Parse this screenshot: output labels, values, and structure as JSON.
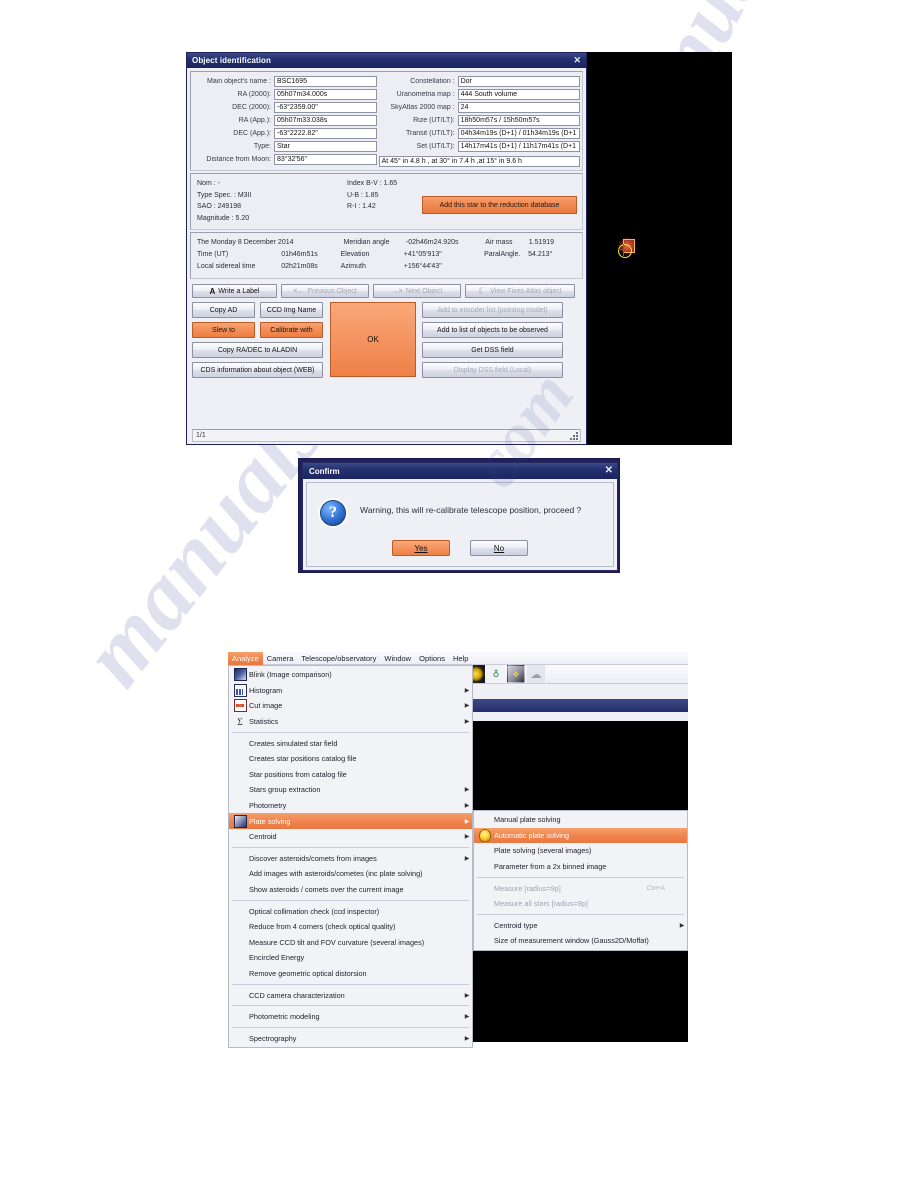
{
  "watermark": {
    "line1": "manualshive.com",
    "line2": "manualshive",
    "line3": "com"
  },
  "object_dialog": {
    "title": "Object identification",
    "close_label": "✕",
    "left_fields": [
      {
        "label": "Main object's name :",
        "value": "BSC1695"
      },
      {
        "label": "RA (2000):",
        "value": "05h07m34.000s"
      },
      {
        "label": "DEC (2000):",
        "value": "-63°2359.00\""
      },
      {
        "label": "RA (App.):",
        "value": "05h07m33.038s"
      },
      {
        "label": "DEC (App.):",
        "value": "-63°2222.82\""
      },
      {
        "label": "Type:",
        "value": "Star"
      },
      {
        "label": "Distance from Moon:",
        "value": "83°32'56\""
      }
    ],
    "right_fields": [
      {
        "label": "Constellation :",
        "value": "Dor"
      },
      {
        "label": "Uranometria map :",
        "value": "444  South volume"
      },
      {
        "label": "SkyAtlas 2000 map :",
        "value": "24"
      },
      {
        "label": "Rize    (UT/LT):",
        "value": "18h50m57s / 15h50m57s"
      },
      {
        "label": "Transit (UT/LT):",
        "value": "04h34m19s (D+1)  / 01h34m19s (D+1"
      },
      {
        "label": "Set     (UT/LT):",
        "value": "14h17m41s (D+1) / 11h17m41s (D+1"
      }
    ],
    "altitude_note": "At 45° in 4.8 h , at 30° in 7.4 h ,at 15° in 9.6 h",
    "catalog": {
      "col1": [
        "Nom : -",
        "Type Spec. : M3II",
        "SAO : 249198",
        "Magnitude : 5.20"
      ],
      "col2": [
        "Index B-V : 1.65",
        "U-B : 1.85",
        "R-I : 1.42"
      ],
      "add_button": "Add this star to the reduction database"
    },
    "ephemeris": {
      "row1": {
        "c1": "The Monday 8 December 2014",
        "c2": "",
        "c3": "Meridian angle",
        "c4": "-02h46m24.920s",
        "c5": "Air mass",
        "c6": "1.51919"
      },
      "row2": {
        "c1": "Time (UT)",
        "c2": "01h46m51s",
        "c3": "Elevation",
        "c4": "+41°05'913\"",
        "c5": "ParalAngle.",
        "c6": "54.213°"
      },
      "row3": {
        "c1": "Local sidereal time",
        "c2": "02h21m08s",
        "c3": "Azimuth",
        "c4": "+156°44'43\"",
        "c5": "",
        "c6": ""
      }
    },
    "buttons": {
      "write_label": "Write a Label",
      "write_label_glyph": "A",
      "previous_object": "Previous Object",
      "previous_glyph": "<←",
      "next_object": "Next Object",
      "next_glyph": "→>",
      "fixed_atlas": "View Fixes Atlas object",
      "moon_glyph": "☾",
      "copy_ad": "Copy AD",
      "ccd_img_name": "CCD Img Name",
      "slew_to": "Slew to",
      "calibrate_with": "Calibrate with",
      "copy_aladin": "Copy RA/DEC to ALADIN",
      "cds_info": "CDS information about object (WEB)",
      "ok": "OK",
      "add_encoder": "Add to encoder list (pointing model)",
      "add_to_list": "Add to list of objects to be observed",
      "get_dss": "Get DSS field",
      "display_dss": "Display DSS field (Local)"
    },
    "status": "1/1"
  },
  "confirm_dialog": {
    "title": "Confirm",
    "close_label": "✕",
    "icon": "?",
    "message": "Warning, this will re-calibrate telescope position, proceed ?",
    "yes": "Yes",
    "no": "No"
  },
  "menu_window": {
    "menubar": [
      {
        "label": "Analyze",
        "active": true
      },
      {
        "label": "Camera",
        "active": false
      },
      {
        "label": "Telescope/observatory",
        "active": false
      },
      {
        "label": "Window",
        "active": false
      },
      {
        "label": "Options",
        "active": false
      },
      {
        "label": "Help",
        "active": false
      }
    ],
    "toolbar": [
      {
        "name": "star-tool",
        "glyph": ""
      },
      {
        "name": "green-tool",
        "glyph": "♁"
      },
      {
        "name": "camera-tool",
        "glyph": "❖"
      },
      {
        "name": "cloud-tool",
        "glyph": "☁"
      }
    ],
    "analyze_menu": [
      {
        "label": "Blink (Image comparison)",
        "icon": "blink-icon",
        "arrow": false,
        "sep_after": false,
        "selected": false,
        "disabled": false
      },
      {
        "label": "Histogram",
        "icon": "histogram-icon",
        "arrow": true,
        "sep_after": false,
        "selected": false,
        "disabled": false
      },
      {
        "label": "Cut image",
        "icon": "cut-image-icon",
        "arrow": true,
        "sep_after": false,
        "selected": false,
        "disabled": false
      },
      {
        "label": "Statistics",
        "icon": "sigma-icon",
        "arrow": true,
        "sep_after": true,
        "selected": false,
        "disabled": false
      },
      {
        "label": "Creates simulated star field",
        "icon": "",
        "arrow": false,
        "sep_after": false,
        "selected": false,
        "disabled": false
      },
      {
        "label": "Creates star positions catalog file",
        "icon": "",
        "arrow": false,
        "sep_after": false,
        "selected": false,
        "disabled": false
      },
      {
        "label": "Star positions from catalog file",
        "icon": "",
        "arrow": false,
        "sep_after": false,
        "selected": false,
        "disabled": false
      },
      {
        "label": "Stars group extraction",
        "icon": "",
        "arrow": true,
        "sep_after": false,
        "selected": false,
        "disabled": false
      },
      {
        "label": "Photometry",
        "icon": "",
        "arrow": true,
        "sep_after": false,
        "selected": false,
        "disabled": false
      },
      {
        "label": "Plate solving",
        "icon": "plate-solving-icon",
        "arrow": true,
        "sep_after": false,
        "selected": true,
        "disabled": false
      },
      {
        "label": "Centroid",
        "icon": "",
        "arrow": true,
        "sep_after": true,
        "selected": false,
        "disabled": false
      },
      {
        "label": "Discover asteroids/comets from images",
        "icon": "",
        "arrow": true,
        "sep_after": false,
        "selected": false,
        "disabled": false
      },
      {
        "label": "Add images with asteroids/cometes (inc plate solving)",
        "icon": "",
        "arrow": false,
        "sep_after": false,
        "selected": false,
        "disabled": false
      },
      {
        "label": "Show asteroids / comets over the current image",
        "icon": "",
        "arrow": false,
        "sep_after": true,
        "selected": false,
        "disabled": false
      },
      {
        "label": "Optical collimation check (ccd inspector)",
        "icon": "",
        "arrow": false,
        "sep_after": false,
        "selected": false,
        "disabled": false
      },
      {
        "label": "Reduce from 4 corners (check optical quality)",
        "icon": "",
        "arrow": false,
        "sep_after": false,
        "selected": false,
        "disabled": false
      },
      {
        "label": "Measure CCD tilt and FOV curvature (several images)",
        "icon": "",
        "arrow": false,
        "sep_after": false,
        "selected": false,
        "disabled": false
      },
      {
        "label": "Encircled Energy",
        "icon": "",
        "arrow": false,
        "sep_after": false,
        "selected": false,
        "disabled": false
      },
      {
        "label": "Remove geometric optical distorsion",
        "icon": "",
        "arrow": false,
        "sep_after": true,
        "selected": false,
        "disabled": false
      },
      {
        "label": "CCD camera characterization",
        "icon": "",
        "arrow": true,
        "sep_after": true,
        "selected": false,
        "disabled": false
      },
      {
        "label": "Photometric modeling",
        "icon": "",
        "arrow": true,
        "sep_after": true,
        "selected": false,
        "disabled": false
      },
      {
        "label": "Spectrography",
        "icon": "",
        "arrow": true,
        "sep_after": false,
        "selected": false,
        "disabled": false
      }
    ],
    "plate_solving_submenu": [
      {
        "label": "Manual plate solving",
        "icon": "",
        "arrow": false,
        "shortcut": "",
        "selected": false,
        "disabled": false,
        "sep_after": false
      },
      {
        "label": "Automatic plate solving",
        "icon": "bulb-icon",
        "arrow": false,
        "shortcut": "",
        "selected": true,
        "disabled": false,
        "sep_after": false
      },
      {
        "label": "Plate solving (several images)",
        "icon": "",
        "arrow": false,
        "shortcut": "",
        "selected": false,
        "disabled": false,
        "sep_after": false
      },
      {
        "label": "Parameter from a 2x binned image",
        "icon": "",
        "arrow": false,
        "shortcut": "",
        "selected": false,
        "disabled": false,
        "sep_after": true
      },
      {
        "label": "Measure [radius=9p]",
        "icon": "",
        "arrow": false,
        "shortcut": "Ctrl+A",
        "selected": false,
        "disabled": true,
        "sep_after": false
      },
      {
        "label": "Measure all stars [radius=9p]",
        "icon": "",
        "arrow": false,
        "shortcut": "",
        "selected": false,
        "disabled": true,
        "sep_after": true
      },
      {
        "label": "Centroid type",
        "icon": "",
        "arrow": true,
        "shortcut": "",
        "selected": false,
        "disabled": false,
        "sep_after": false
      },
      {
        "label": "Size of measurement window (Gauss2D/Moffat)",
        "icon": "",
        "arrow": false,
        "shortcut": "",
        "selected": false,
        "disabled": false,
        "sep_after": false
      }
    ]
  }
}
